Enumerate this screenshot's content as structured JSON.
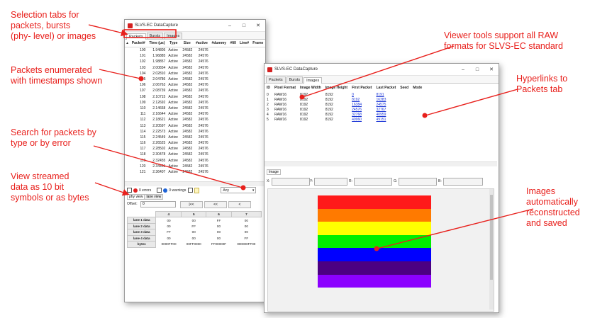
{
  "annotations": {
    "tabs_note": [
      "Selection tabs for",
      "packets, bursts",
      "(phy- level) or images"
    ],
    "packets_note": [
      "Packets enumerated",
      "with timestamps shown"
    ],
    "search_note": [
      "Search for packets by",
      "type or by error"
    ],
    "view_note": [
      "View streamed",
      "data as 10 bit",
      "symbols or as bytes"
    ],
    "viewer_note": [
      "Viewer tools support all RAW",
      "formats for SLVS-EC standard"
    ],
    "hyperlinks_note": [
      "Hyperlinks to",
      "Packets tab"
    ],
    "images_note": [
      "Images",
      "automatically",
      "reconstructed",
      "and saved"
    ],
    "color": "#e8201c"
  },
  "packets_window": {
    "title": "SLVS-EC DataCapture",
    "tabs": [
      "Packets",
      "Bursts",
      "Images"
    ],
    "columns": [
      "▴",
      "Packet#",
      "Time (μs)",
      "Type",
      "Size",
      "#active",
      "#dummy",
      "#fill",
      "Line#",
      "Frame"
    ],
    "rows": [
      [
        "100",
        "1.94805",
        "Active",
        "24582",
        "24576"
      ],
      [
        "101",
        "1.96885",
        "Active",
        "24582",
        "24576"
      ],
      [
        "102",
        "1.98857",
        "Active",
        "24582",
        "24576"
      ],
      [
        "103",
        "2.00834",
        "Active",
        "24582",
        "24576"
      ],
      [
        "104",
        "2.02810",
        "Active",
        "24582",
        "24576"
      ],
      [
        "105",
        "2.04786",
        "Active",
        "24582",
        "24576"
      ],
      [
        "106",
        "2.06763",
        "Active",
        "24582",
        "24576"
      ],
      [
        "107",
        "2.08739",
        "Active",
        "24582",
        "24576"
      ],
      [
        "108",
        "2.10715",
        "Active",
        "24582",
        "24576"
      ],
      [
        "109",
        "2.12692",
        "Active",
        "24582",
        "24576"
      ],
      [
        "110",
        "2.14668",
        "Active",
        "24582",
        "24576"
      ],
      [
        "111",
        "2.16644",
        "Active",
        "24582",
        "24576"
      ],
      [
        "112",
        "2.18621",
        "Active",
        "24582",
        "24576"
      ],
      [
        "113",
        "2.20597",
        "Active",
        "24582",
        "24576"
      ],
      [
        "114",
        "2.22573",
        "Active",
        "24582",
        "24576"
      ],
      [
        "115",
        "2.24549",
        "Active",
        "24582",
        "24576"
      ],
      [
        "116",
        "2.26525",
        "Active",
        "24582",
        "24576"
      ],
      [
        "117",
        "2.28502",
        "Active",
        "24582",
        "24576"
      ],
      [
        "118",
        "2.30478",
        "Active",
        "24582",
        "24576"
      ],
      [
        "119",
        "2.32455",
        "Active",
        "24582",
        "24576"
      ],
      [
        "120",
        "2.34431",
        "Active",
        "24582",
        "24576"
      ],
      [
        "121",
        "2.36407",
        "Active",
        "24582",
        "24576"
      ]
    ],
    "filter": {
      "errors": "0 errors",
      "warnings": "0 warnings",
      "type_select": "Any"
    },
    "view_tabs": [
      "phy view",
      "lane view"
    ],
    "offset_label": "Offset:",
    "offset_value": "0",
    "nav_buttons": [
      "|<<",
      "<<",
      "<"
    ],
    "lane_columns": [
      "4",
      "5",
      "6",
      "7"
    ],
    "lane_rows": [
      {
        "label": "lane 1 data",
        "values": [
          "00",
          "00",
          "FF",
          "00"
        ]
      },
      {
        "label": "lane 2 data",
        "values": [
          "00",
          "FF",
          "00",
          "00"
        ]
      },
      {
        "label": "lane 3 data",
        "values": [
          "FF",
          "00",
          "00",
          "00"
        ]
      },
      {
        "label": "lane 4 data",
        "values": [
          "00",
          "00",
          "00",
          "FF"
        ]
      },
      {
        "label": "bytes",
        "values": [
          "0000FF00",
          "00FF0000",
          "FF00000F",
          "000000FF00"
        ]
      }
    ]
  },
  "images_window": {
    "title": "SLVS-EC DataCapture",
    "tabs": [
      "Packets",
      "Bursts",
      "Images"
    ],
    "columns": [
      "ID",
      "Pixel Format",
      "Image Width",
      "Image Height",
      "First Packet",
      "Last Packet",
      "Seed",
      "Mode"
    ],
    "rows": [
      [
        "0",
        "RAW16",
        "8192",
        "8192",
        "0",
        "8191"
      ],
      [
        "1",
        "RAW16",
        "8192",
        "8192",
        "8192",
        "16383"
      ],
      [
        "2",
        "RAW16",
        "8192",
        "8192",
        "16384",
        "24575"
      ],
      [
        "3",
        "RAW16",
        "8192",
        "8192",
        "24576",
        "32767"
      ],
      [
        "4",
        "RAW16",
        "8192",
        "8192",
        "32768",
        "40959"
      ],
      [
        "5",
        "RAW16",
        "8192",
        "8192",
        "40960",
        "49151"
      ]
    ],
    "image_panel_label": "Image",
    "coord_labels": [
      "X:",
      "Y:",
      "R:",
      "G:",
      "B:"
    ],
    "image_stripes": [
      "#ff1a1a",
      "#ff7a00",
      "#ffff00",
      "#00ee00",
      "#0000ff",
      "#4b0082",
      "#8b00ff"
    ]
  }
}
